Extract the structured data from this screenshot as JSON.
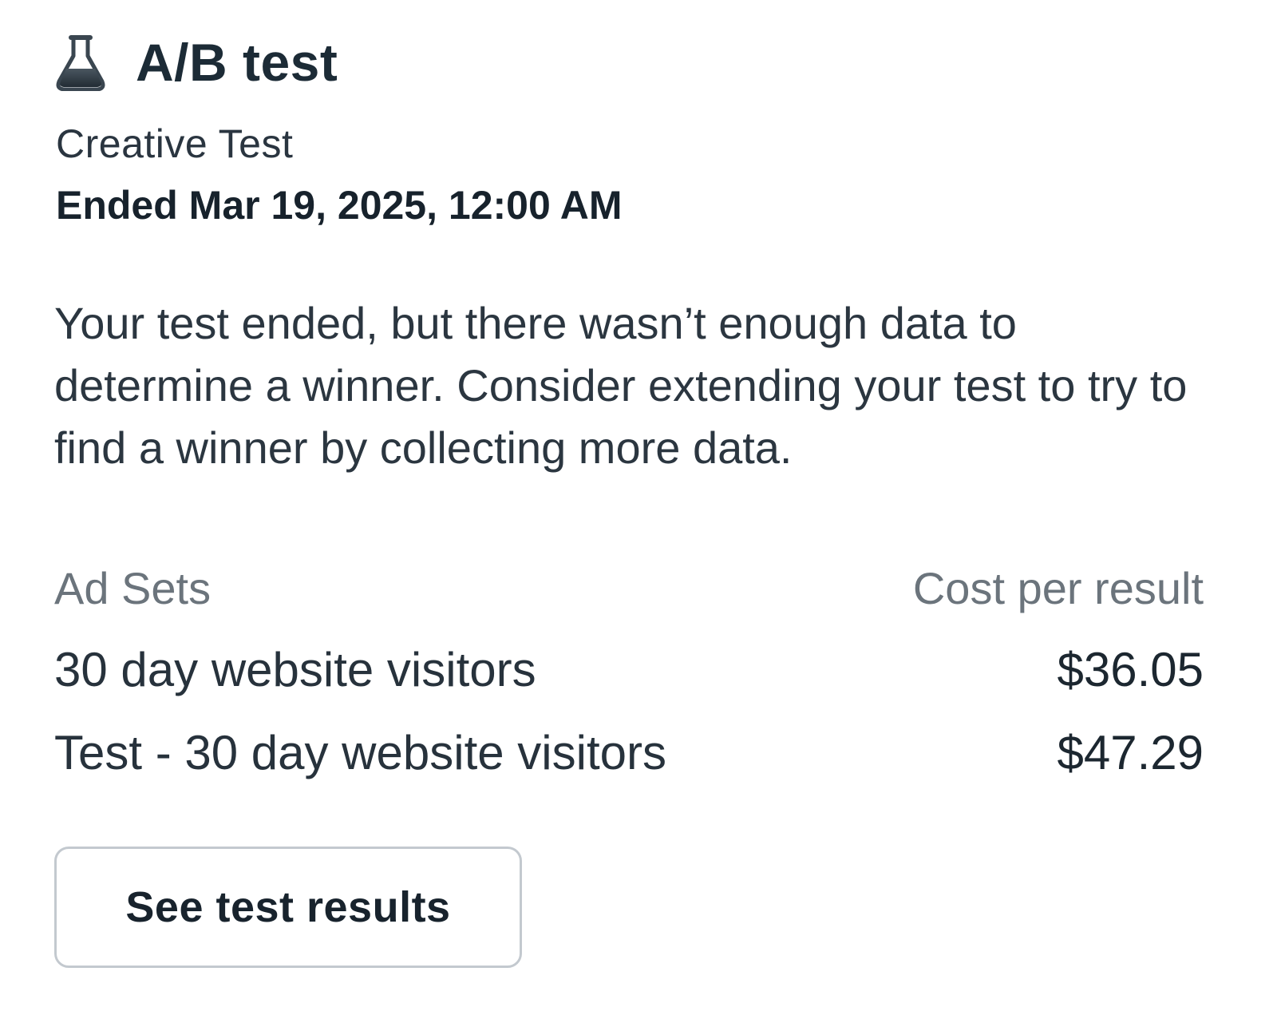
{
  "card": {
    "icon": "flask-icon",
    "title": "A/B test",
    "subtitle": "Creative Test",
    "ended": "Ended Mar 19, 2025, 12:00 AM",
    "message": "Your test ended, but there wasn’t enough data to determine a winner. Consider extending your test to try to find a winner by collecting more data."
  },
  "table": {
    "headers": {
      "name": "Ad Sets",
      "metric": "Cost per result"
    },
    "rows": [
      {
        "name": "30 day website visitors",
        "value": "$36.05"
      },
      {
        "name": "Test - 30 day website visitors",
        "value": "$47.29"
      }
    ]
  },
  "button": {
    "label": "See test results"
  },
  "colors": {
    "text": "#1f2a33",
    "muted": "#6b747c",
    "border": "#c3c9cf",
    "icon": "#2f3b45"
  }
}
